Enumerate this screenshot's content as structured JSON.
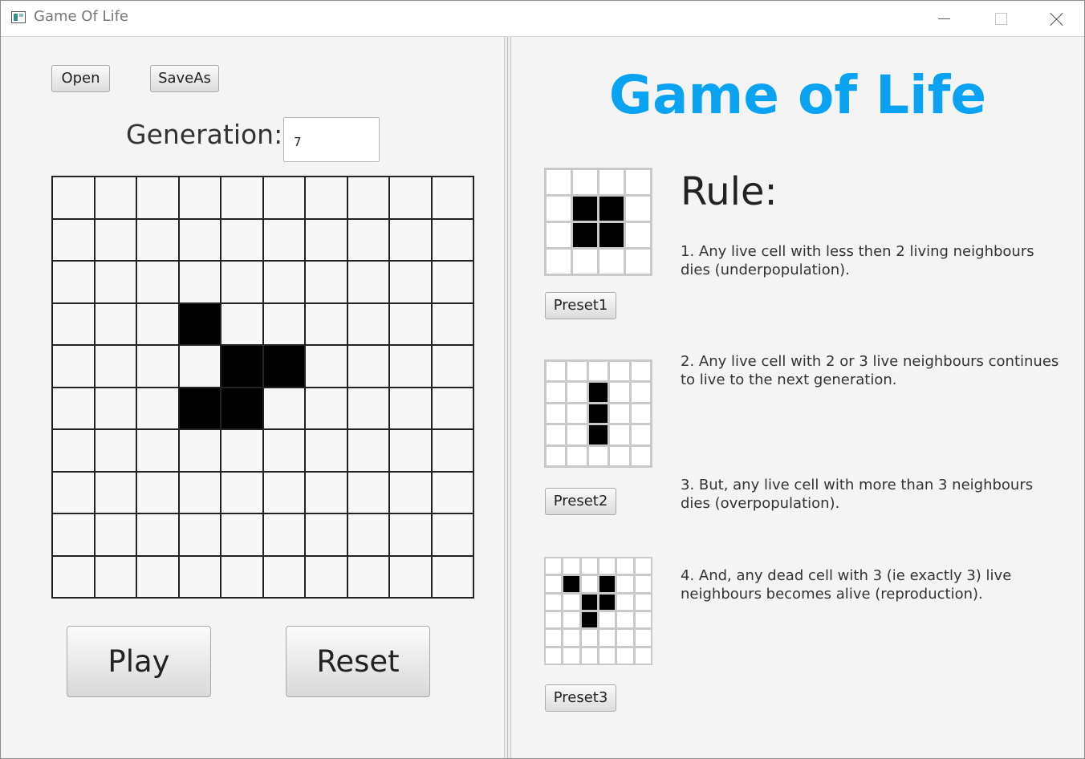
{
  "window": {
    "title": "Game Of Life",
    "controls": [
      "minimize",
      "maximize",
      "close"
    ]
  },
  "left": {
    "open_label": "Open",
    "saveas_label": "SaveAs",
    "generation_label": "Generation:",
    "generation_value": "7",
    "grid": {
      "rows": 10,
      "cols": 10,
      "alive": [
        [
          3,
          3
        ],
        [
          4,
          4
        ],
        [
          4,
          5
        ],
        [
          5,
          3
        ],
        [
          5,
          4
        ]
      ]
    },
    "play_label": "Play",
    "reset_label": "Reset"
  },
  "right": {
    "app_title": "Game of Life",
    "rule_heading": "Rule:",
    "rules": [
      "1. Any live cell with less then 2 living neighbours dies (underpopulation).",
      "2. Any live cell with 2 or 3 live neighbours continues to live to the next generation.",
      "3. But, any live cell with more than 3 neighbours dies (overpopulation).",
      "4. And, any dead cell with 3 (ie exactly 3) live neighbours becomes alive (reproduction)."
    ],
    "presets": [
      {
        "label": "Preset1",
        "rows": 4,
        "cols": 4,
        "alive": [
          [
            1,
            1
          ],
          [
            1,
            2
          ],
          [
            2,
            1
          ],
          [
            2,
            2
          ]
        ]
      },
      {
        "label": "Preset2",
        "rows": 5,
        "cols": 5,
        "alive": [
          [
            1,
            2
          ],
          [
            2,
            2
          ],
          [
            3,
            2
          ]
        ]
      },
      {
        "label": "Preset3",
        "rows": 6,
        "cols": 6,
        "alive": [
          [
            1,
            1
          ],
          [
            1,
            3
          ],
          [
            2,
            2
          ],
          [
            2,
            3
          ],
          [
            3,
            2
          ]
        ]
      }
    ]
  },
  "colors": {
    "title_accent": "#0aa3f3",
    "alive_cell": "#000000",
    "dead_cell": "#ffffff",
    "grid_line": "#222222",
    "preset_grid_line": "#c9c9c9"
  }
}
